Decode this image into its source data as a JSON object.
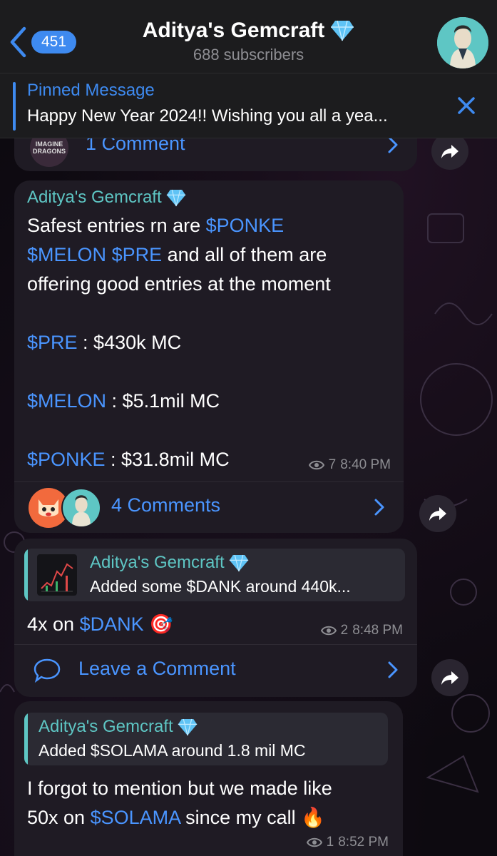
{
  "header": {
    "back_count": "451",
    "title": "Aditya's Gemcraft",
    "subtitle": "688 subscribers"
  },
  "pinned": {
    "label": "Pinned Message",
    "text": "Happy New Year 2024!! Wishing you all a yea..."
  },
  "messages": [
    {
      "comments_label": "1 Comment",
      "avatar_text": "IMAGINE DRAGONS"
    },
    {
      "sender": "Aditya's Gemcraft",
      "line1_pre": "Safest entries rn are ",
      "line1_link": "$PONKE",
      "line2_link1": "$MELON",
      "line2_sp": " ",
      "line2_link2": "$PRE",
      "line2_post": " and all of them are",
      "line3": "offering good entries at the moment",
      "pre_link": "$PRE",
      "pre_val": " : $430k MC",
      "melon_link": "$MELON",
      "melon_val": " : $5.1mil MC",
      "ponke_link": "$PONKE",
      "ponke_val": " : $31.8mil MC",
      "views": "7",
      "time": "8:40 PM",
      "comments_label": "4 Comments"
    },
    {
      "quote_sender": "Aditya's Gemcraft",
      "quote_text": "Added some $DANK around 440k...",
      "text_pre": "4x on ",
      "text_link": "$DANK",
      "emoji": "🎯",
      "views": "2",
      "time": "8:48 PM",
      "comments_label": "Leave a Comment"
    },
    {
      "quote_sender": "Aditya's Gemcraft",
      "quote_text": "Added $SOLAMA around 1.8 mil MC",
      "line1": "I forgot to mention but we made like",
      "line2_pre": "50x on ",
      "line2_link": "$SOLAMA",
      "line2_post": " since my call ",
      "emoji": "🔥",
      "views": "1",
      "time": "8:52 PM"
    }
  ],
  "colors": {
    "accent": "#3e8af0",
    "link": "#4a95ff",
    "sender": "#5ec6c4",
    "bubble": "#1f1b24",
    "header": "#1c1c1e"
  }
}
